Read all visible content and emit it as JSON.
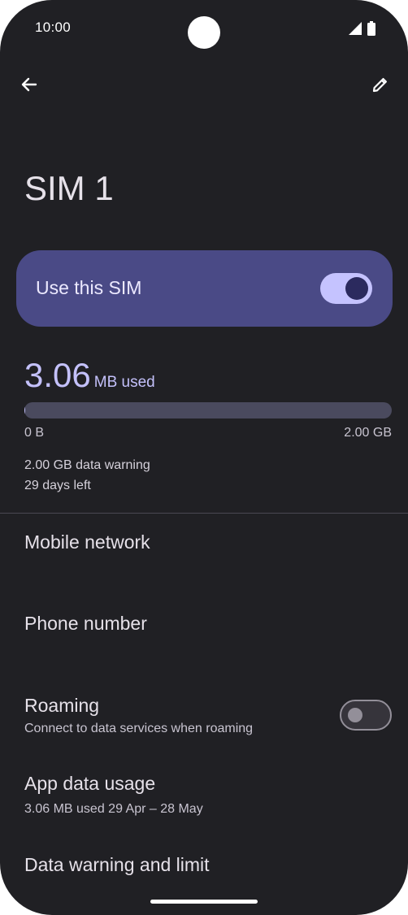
{
  "status_bar": {
    "time": "10:00",
    "icons": [
      "signal-icon",
      "battery-icon"
    ]
  },
  "top_bar": {
    "back_icon": "arrow-left-icon",
    "edit_icon": "pencil-icon"
  },
  "page": {
    "title": "SIM 1"
  },
  "sim_toggle": {
    "label": "Use this SIM",
    "enabled": true
  },
  "usage": {
    "amount": "3.06",
    "unit": "MB used",
    "min_label": "0 B",
    "max_label": "2.00 GB",
    "fraction_used": 0.0015,
    "warning": "2.00 GB data warning",
    "days_left": "29 days left"
  },
  "settings": {
    "mobile_network": {
      "title": "Mobile network"
    },
    "phone_number": {
      "title": "Phone number"
    },
    "roaming": {
      "title": "Roaming",
      "subtitle": "Connect to data services when roaming",
      "enabled": false
    },
    "app_data_usage": {
      "title": "App data usage",
      "subtitle": "3.06 MB used 29 Apr – 28 May"
    },
    "data_warning": {
      "title": "Data warning and limit"
    }
  },
  "colors": {
    "background": "#202024",
    "accent": "#c4c1fb",
    "card": "#4a4a86",
    "text_primary": "#e6e1e9",
    "text_secondary": "#c8c4d0"
  }
}
